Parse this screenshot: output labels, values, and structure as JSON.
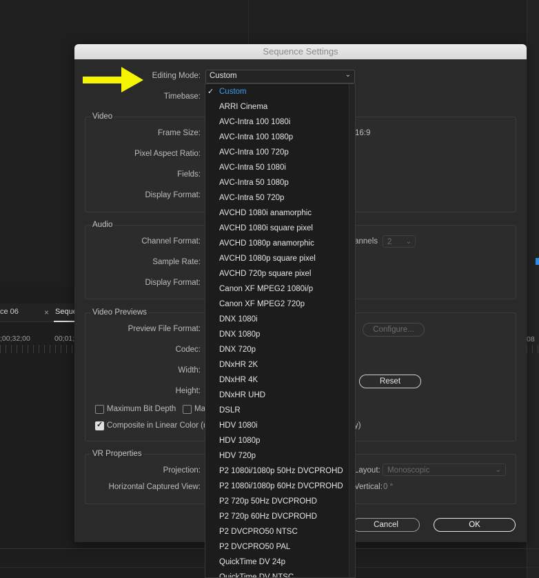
{
  "background": {
    "tab1": "ce 06",
    "tab_close": "×",
    "tab2": "Seque",
    "timecode1": ";00;32;00",
    "timecode2": "00;01;",
    "timecode3": "08"
  },
  "dialog": {
    "title": "Sequence Settings",
    "editing_mode_label": "Editing Mode:",
    "editing_mode_value": "Custom",
    "timebase_label": "Timebase:",
    "video": {
      "title": "Video",
      "frame_size_label": "Frame Size:",
      "frame_size_aspect": "16:9",
      "pixel_aspect_label": "Pixel Aspect Ratio:",
      "fields_label": "Fields:",
      "display_format_label": "Display Format:"
    },
    "audio": {
      "title": "Audio",
      "channel_format_label": "Channel Format:",
      "channels_label": "Channels:",
      "channels_value": "2",
      "sample_rate_label": "Sample Rate:",
      "display_format_label": "Display Format:"
    },
    "previews": {
      "title": "Video Previews",
      "preview_format_label": "Preview File Format:",
      "configure_label": "Configure...",
      "codec_label": "Codec:",
      "width_label": "Width:",
      "reset_label": "Reset",
      "height_label": "Height:",
      "max_bit_depth_label": "Maximum Bit Depth",
      "max_render_label": "Ma",
      "composite_label": "Composite in Linear Color (re",
      "composite_tail": "y)"
    },
    "vr": {
      "title": "VR Properties",
      "projection_label": "Projection:",
      "layout_label": "Layout:",
      "layout_value": "Monoscopic",
      "h_view_label": "Horizontal Captured View:",
      "vertical_label": "Vertical:",
      "vertical_value": "0 °"
    },
    "cancel_label": "Cancel",
    "ok_label": "OK"
  },
  "editing_mode_options": [
    "Custom",
    "ARRI Cinema",
    "AVC-Intra 100 1080i",
    "AVC-Intra 100 1080p",
    "AVC-Intra 100 720p",
    "AVC-Intra 50 1080i",
    "AVC-Intra 50 1080p",
    "AVC-Intra 50 720p",
    "AVCHD 1080i anamorphic",
    "AVCHD 1080i square pixel",
    "AVCHD 1080p anamorphic",
    "AVCHD 1080p square pixel",
    "AVCHD 720p square pixel",
    "Canon XF MPEG2 1080i/p",
    "Canon XF MPEG2 720p",
    "DNX 1080i",
    "DNX 1080p",
    "DNX 720p",
    "DNxHR 2K",
    "DNxHR 4K",
    "DNxHR UHD",
    "DSLR",
    "HDV 1080i",
    "HDV 1080p",
    "HDV 720p",
    "P2 1080i/1080p 50Hz DVCPROHD",
    "P2 1080i/1080p 60Hz DVCPROHD",
    "P2 720p 50Hz DVCPROHD",
    "P2 720p 60Hz DVCPROHD",
    "P2 DVCPRO50 NTSC",
    "P2 DVCPRO50 PAL",
    "QuickTime DV 24p",
    "QuickTime DV NTSC"
  ],
  "selected_option": "Custom",
  "colors": {
    "selected_item": "#3e9cf2",
    "arrow": "#f5f500"
  }
}
